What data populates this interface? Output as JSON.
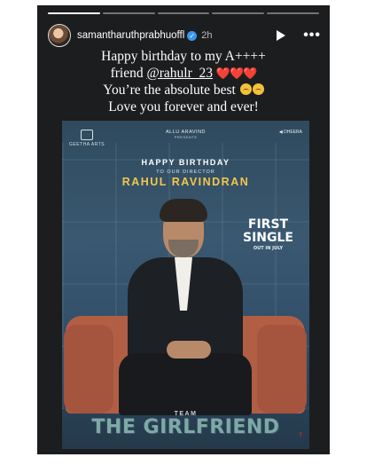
{
  "story": {
    "progress_segments": 5,
    "progress_completed": 1,
    "username": "samantharuthprabhuoffl",
    "verified_glyph": "✓",
    "time": "2h",
    "icons": [
      "play-icon",
      "more-icon",
      "verified-icon"
    ]
  },
  "caption": {
    "line1": "Happy birthday to my A++++",
    "line2_prefix": "friend ",
    "mention": "@rahulr_23",
    "hearts": "❤️❤️❤️",
    "line3": "You’re the absolute best",
    "line4": "Love you forever and ever!"
  },
  "poster": {
    "brand_left": "GEETHA ARTS",
    "brand_mid": "ALLU ARAVIND",
    "brand_mid_sub": "PRESENTS",
    "brand_right": "◀ DHEERA",
    "happy_birthday": "HAPPY BIRTHDAY",
    "to_our_director": "TO OUR DIRECTOR",
    "director_name": "RAHUL RAVINDRAN",
    "first_single_line1": "FIRST",
    "first_single_line2": "SINGLE",
    "first_single_sub": "OUT IN JULY",
    "team": "TEAM",
    "film_title": "THE GIRLFRIEND",
    "corner_logo": "T"
  },
  "colors": {
    "story_bg": "#1c1d1f",
    "director_name": "#f4c64b",
    "film_title": "#7fa8a8",
    "hearts": "#e0242b",
    "verified": "#3897f0"
  }
}
